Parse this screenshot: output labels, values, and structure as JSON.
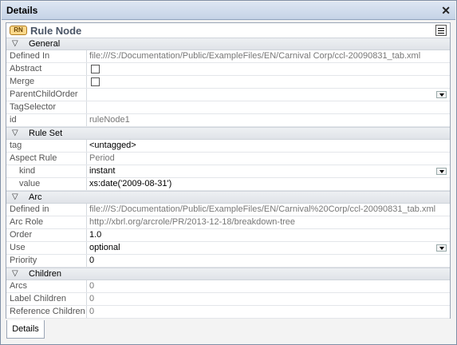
{
  "window": {
    "title": "Details",
    "close_glyph": "✕"
  },
  "node": {
    "badge": "RN",
    "title": "Rule Node",
    "menu_icon": "properties-menu-icon"
  },
  "groups": {
    "general": "General",
    "rule_set": "Rule Set",
    "arc": "Arc",
    "children": "Children"
  },
  "general": {
    "defined_in": {
      "key": "Defined In",
      "value": "file:///S:/Documentation/Public/ExampleFiles/EN/Carnival Corp/ccl-20090831_tab.xml"
    },
    "abstract": {
      "key": "Abstract",
      "checked": false
    },
    "merge": {
      "key": "Merge",
      "checked": false
    },
    "parent_child_order": {
      "key": "ParentChildOrder",
      "value": ""
    },
    "tag_selector": {
      "key": "TagSelector",
      "value": ""
    },
    "id": {
      "key": "id",
      "value": "ruleNode1"
    }
  },
  "rule_set": {
    "tag": {
      "key": "tag",
      "value": "<untagged>"
    },
    "aspect_rule": {
      "key": "Aspect Rule",
      "value": "Period"
    },
    "kind": {
      "key": "kind",
      "value": "instant"
    },
    "value": {
      "key": "value",
      "value": "xs:date('2009-08-31')"
    }
  },
  "arc": {
    "defined_in": {
      "key": "Defined in",
      "value": "file:///S:/Documentation/Public/ExampleFiles/EN/Carnival%20Corp/ccl-20090831_tab.xml"
    },
    "arc_role": {
      "key": "Arc Role",
      "value": "http://xbrl.org/arcrole/PR/2013-12-18/breakdown-tree"
    },
    "order": {
      "key": "Order",
      "value": "1.0"
    },
    "use": {
      "key": "Use",
      "value": "optional"
    },
    "priority": {
      "key": "Priority",
      "value": "0"
    }
  },
  "children": {
    "arcs": {
      "key": "Arcs",
      "value": "0"
    },
    "label_children": {
      "key": "Label Children",
      "value": "0"
    },
    "reference_children": {
      "key": "Reference Children",
      "value": "0"
    }
  },
  "tabs": {
    "details": "Details"
  }
}
